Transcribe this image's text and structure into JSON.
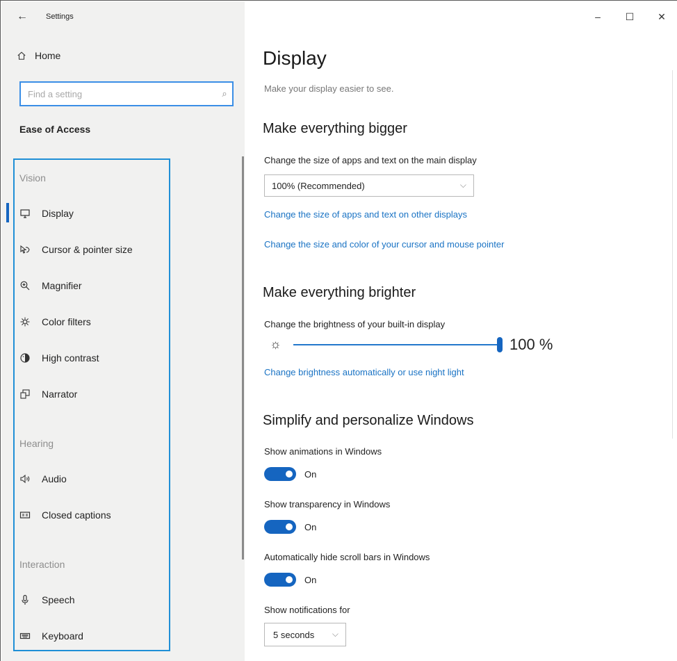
{
  "window": {
    "title": "Settings",
    "controls": {
      "minimize": "–",
      "maximize": "☐",
      "close": "✕"
    }
  },
  "sidebar": {
    "home_label": "Home",
    "search_placeholder": "Find a setting",
    "section_title": "Ease of Access",
    "groups": [
      {
        "label": "Vision",
        "items": [
          {
            "label": "Display",
            "icon": "monitor-icon",
            "selected": true
          },
          {
            "label": "Cursor & pointer size",
            "icon": "cursor-icon"
          },
          {
            "label": "Magnifier",
            "icon": "magnifier-icon"
          },
          {
            "label": "Color filters",
            "icon": "color-filter-icon"
          },
          {
            "label": "High contrast",
            "icon": "high-contrast-icon"
          },
          {
            "label": "Narrator",
            "icon": "narrator-icon"
          }
        ]
      },
      {
        "label": "Hearing",
        "items": [
          {
            "label": "Audio",
            "icon": "speaker-icon"
          },
          {
            "label": "Closed captions",
            "icon": "captions-icon"
          }
        ]
      },
      {
        "label": "Interaction",
        "items": [
          {
            "label": "Speech",
            "icon": "microphone-icon"
          },
          {
            "label": "Keyboard",
            "icon": "keyboard-icon"
          }
        ]
      }
    ]
  },
  "main": {
    "title": "Display",
    "description": "Make your display easier to see.",
    "bigger": {
      "heading": "Make everything bigger",
      "size_label": "Change the size of apps and text on the main display",
      "size_value": "100% (Recommended)",
      "link_other_displays": "Change the size of apps and text on other displays",
      "link_cursor": "Change the size and color of your cursor and mouse pointer"
    },
    "brighter": {
      "heading": "Make everything brighter",
      "brightness_label": "Change the brightness of your built-in display",
      "brightness_value": "100 %",
      "brightness_level": 1.0,
      "link_auto": "Change brightness automatically or use night light"
    },
    "simplify": {
      "heading": "Simplify and personalize Windows",
      "animations_label": "Show animations in Windows",
      "animations_state": "On",
      "transparency_label": "Show transparency in Windows",
      "transparency_state": "On",
      "scrollbars_label": "Automatically hide scroll bars in Windows",
      "scrollbars_state": "On",
      "notifications_label": "Show notifications for",
      "notifications_value": "5 seconds"
    }
  },
  "colors": {
    "accent": "#1565c0",
    "link": "#1a73c4",
    "highlight_frame": "#1f8fd6"
  }
}
